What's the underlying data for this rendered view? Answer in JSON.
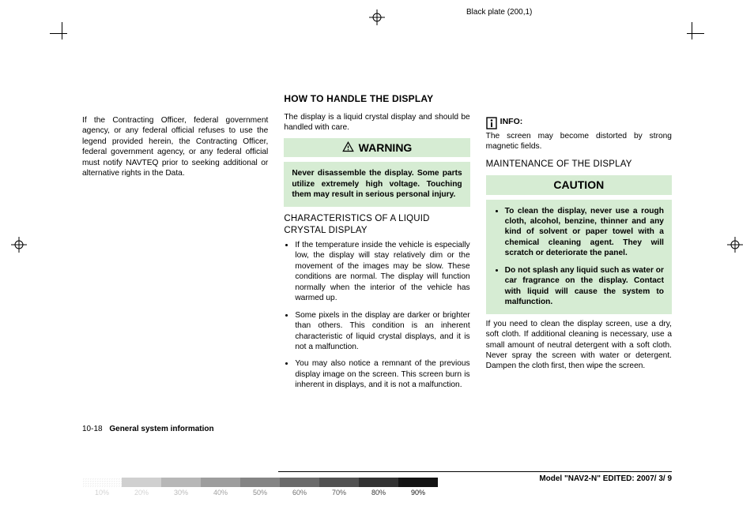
{
  "plate": "Black plate (200,1)",
  "col1": {
    "p1": "If the Contracting Officer, federal government agency, or any federal official refuses to use the legend provided herein, the Contracting Officer, federal government agency, or any federal official must notify NAVTEQ prior to seeking additional or alternative rights in the Data."
  },
  "col2": {
    "h2": "HOW TO HANDLE THE DISPLAY",
    "intro": "The display is a liquid crystal display and should be handled with care.",
    "warn_hd": "WARNING",
    "warn_body": "Never disassemble the display. Some parts utilize extremely high voltage. Touching them may result in serious personal injury.",
    "h3": "CHARACTERISTICS OF A LIQUID CRYSTAL DISPLAY",
    "li1": "If the temperature inside the vehicle is especially low, the display will stay relatively dim or the movement of the images may be slow. These conditions are normal. The display will function normally when the interior of the vehicle has warmed up.",
    "li2": "Some pixels in the display are darker or brighter than others. This condition is an inherent characteristic of liquid crystal displays, and it is not a malfunction.",
    "li3": "You may also notice a remnant of the previous display image on the screen. This screen burn is inherent in displays, and it is not a malfunction."
  },
  "col3": {
    "info_lbl": "INFO:",
    "info_txt": "The screen may become distorted by strong magnetic fields.",
    "h3": "MAINTENANCE OF THE DISPLAY",
    "caut_hd": "CAUTION",
    "c_li1": "To clean the display, never use a rough cloth, alcohol, benzine, thinner and any kind of solvent or paper towel with a chemical cleaning agent. They will scratch or deteriorate the panel.",
    "c_li2": "Do not splash any liquid such as water or car fragrance on the display. Contact with liquid will cause the system to malfunction.",
    "after": "If you need to clean the display screen, use a dry, soft cloth. If additional cleaning is necessary, use a small amount of neutral detergent with a soft cloth. Never spray the screen with water or detergent. Dampen the cloth first, then wipe the screen."
  },
  "footer": {
    "page_no": "10-18",
    "title": "General system information",
    "model": "Model \"NAV2-N\"  EDITED:  2007/ 3/ 9"
  },
  "wedge": [
    "10%",
    "20%",
    "30%",
    "40%",
    "50%",
    "60%",
    "70%",
    "80%",
    "90%"
  ]
}
